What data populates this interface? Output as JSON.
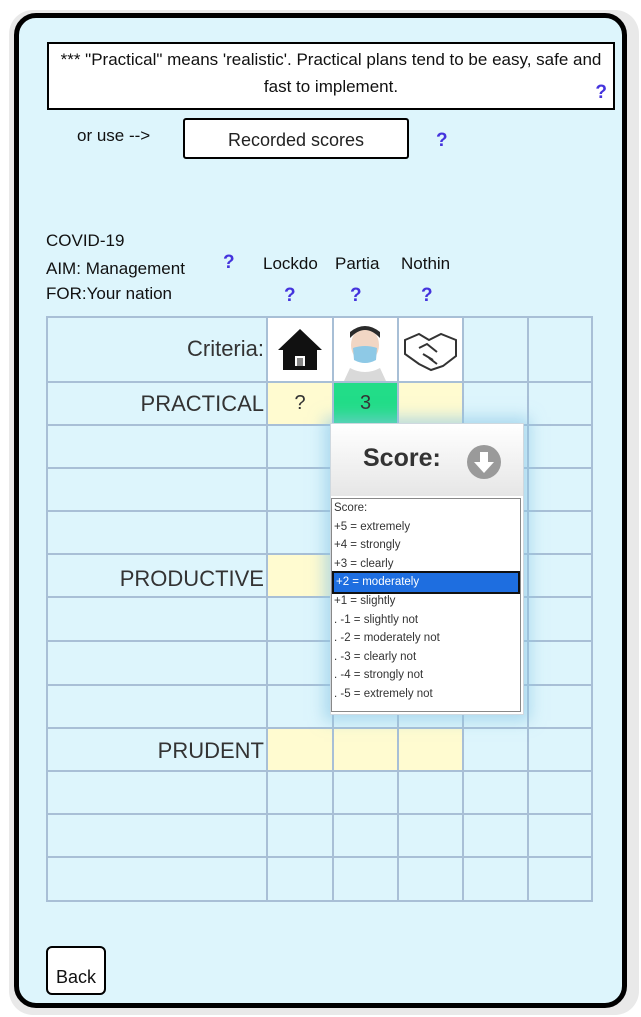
{
  "note": {
    "text": "*** \"Practical\" means 'realistic'. Practical plans tend to be easy, safe and fast to implement.",
    "help": "?"
  },
  "or_use": {
    "label": "or use -->",
    "button": "Recorded scores",
    "help": "?"
  },
  "topic": {
    "subject": "COVID-19",
    "aim_label": "AIM:",
    "aim_value": "Management",
    "aim_help": "?",
    "for_label": "FOR:",
    "for_value": "Your nation"
  },
  "options": [
    {
      "name": "Lockdo",
      "help": "?",
      "icon": "house-icon"
    },
    {
      "name": "Partia",
      "help": "?",
      "icon": "face-mask-icon"
    },
    {
      "name": "Nothin",
      "help": "?",
      "icon": "handshake-icon"
    }
  ],
  "grid": {
    "criteria_label": "Criteria:",
    "rows": [
      "PRACTICAL",
      "PRODUCTIVE",
      "PRUDENT"
    ],
    "practical_scores": [
      "?",
      "3",
      ""
    ]
  },
  "popup": {
    "title": "Score:",
    "icon": "arrow-down-circle-icon",
    "list_items": [
      "Score:",
      "+5 = extremely",
      "+4 = strongly",
      "+3 = clearly",
      "+2 = moderately",
      "+1 = slightly",
      ". -1 = slightly not",
      ". -2 = moderately not",
      ". -3 = clearly not",
      ". -4 = strongly not",
      ". -5 = extremely not"
    ],
    "selected_index": 4
  },
  "back_button": "Back",
  "colors": {
    "background": "#ddf5fc",
    "help_blue": "#4433dd",
    "score_green": "#22dd88",
    "score_yellow": "#fffbd0",
    "selected_blue": "#1e6ee0"
  }
}
